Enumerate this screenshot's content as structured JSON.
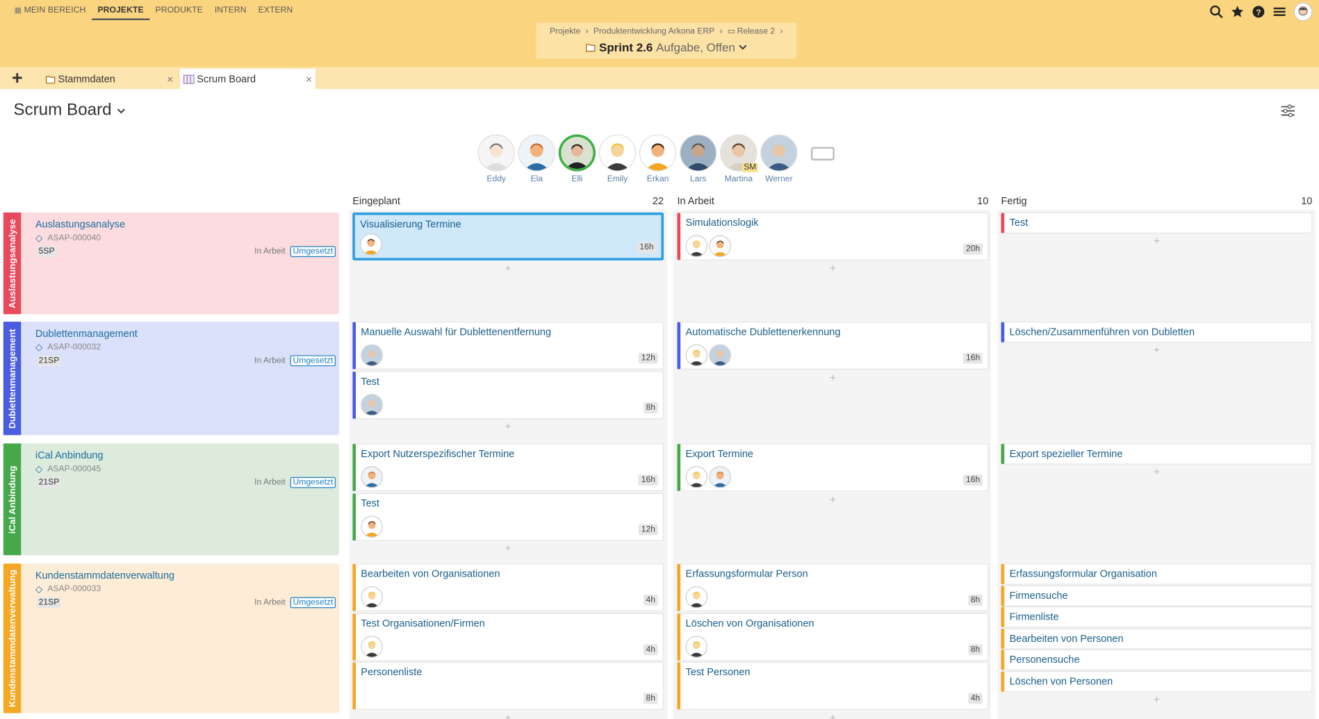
{
  "topnav": {
    "items": [
      {
        "label": "MEIN BEREICH"
      },
      {
        "label": "PROJEKTE"
      },
      {
        "label": "PRODUKTE"
      },
      {
        "label": "INTERN"
      },
      {
        "label": "EXTERN"
      }
    ]
  },
  "breadcrumb": {
    "items": [
      "Projekte",
      "Produktentwicklung Arkona ERP",
      "Release 2"
    ],
    "sprint_name": "Sprint 2.6",
    "sprint_status": "Aufgabe, Offen"
  },
  "tabs": [
    {
      "label": "Stammdaten"
    },
    {
      "label": "Scrum Board"
    }
  ],
  "page": {
    "title": "Scrum Board"
  },
  "team": {
    "members": [
      "Eddy",
      "Ela",
      "Elli",
      "Emily",
      "Erkan",
      "Lars",
      "Martina",
      "Werner"
    ],
    "sm_badge": "SM"
  },
  "columns": [
    {
      "name": "Eingeplant",
      "count": "22"
    },
    {
      "name": "In Arbeit",
      "count": "10"
    },
    {
      "name": "Fertig",
      "count": "10"
    }
  ],
  "rows": [
    {
      "title": "Auslastungsanalyse",
      "id": "ASAP-000040",
      "sp": "5SP",
      "status": "In Arbeit",
      "badge": "Umgesetzt",
      "color": "#e9495c",
      "bg": "#fddcdf"
    },
    {
      "title": "Dublettenmanagement",
      "id": "ASAP-000032",
      "sp": "21SP",
      "status": "In Arbeit",
      "badge": "Umgesetzt",
      "color": "#4a5ce0",
      "bg": "#dbe0fb"
    },
    {
      "title": "iCal Anbindung",
      "id": "ASAP-000045",
      "sp": "21SP",
      "status": "In Arbeit",
      "badge": "Umgesetzt",
      "color": "#46a84a",
      "bg": "#dcebdc"
    },
    {
      "title": "Kundenstammdatenverwaltung",
      "id": "ASAP-000033",
      "sp": "21SP",
      "status": "In Arbeit",
      "badge": "Umgesetzt",
      "color": "#f5a623",
      "bg": "#fdecd6"
    }
  ],
  "cards": {
    "r0c0": [
      {
        "title": "Visualisierung Termine",
        "hours": "16h"
      }
    ],
    "r0c1": [
      {
        "title": "Simulationslogik",
        "hours": "20h"
      }
    ],
    "r0c2": [
      {
        "title": "Test"
      }
    ],
    "r1c0": [
      {
        "title": "Manuelle Auswahl für Dublettenentfernung",
        "hours": "12h"
      },
      {
        "title": "Test",
        "hours": "8h"
      }
    ],
    "r1c1": [
      {
        "title": "Automatische Dublettenerkennung",
        "hours": "16h"
      }
    ],
    "r1c2": [
      {
        "title": "Löschen/Zusammenführen von Dubletten"
      }
    ],
    "r2c0": [
      {
        "title": "Export Nutzerspezifischer Termine",
        "hours": "16h"
      },
      {
        "title": "Test",
        "hours": "12h"
      }
    ],
    "r2c1": [
      {
        "title": "Export Termine",
        "hours": "16h"
      }
    ],
    "r2c2": [
      {
        "title": "Export spezieller Termine"
      }
    ],
    "r3c0": [
      {
        "title": "Bearbeiten von Organisationen",
        "hours": "4h"
      },
      {
        "title": "Test Organisationen/Firmen",
        "hours": "4h"
      },
      {
        "title": "Personenliste",
        "hours": "8h"
      }
    ],
    "r3c1": [
      {
        "title": "Erfassungsformular Person",
        "hours": "8h"
      },
      {
        "title": "Löschen von Organisationen",
        "hours": "8h"
      },
      {
        "title": "Test Personen",
        "hours": "4h"
      }
    ],
    "r3c2": [
      {
        "title": "Erfassungsformular Organisation"
      },
      {
        "title": "Firmensuche"
      },
      {
        "title": "Firmenliste"
      },
      {
        "title": "Bearbeiten von Personen"
      },
      {
        "title": "Personensuche"
      },
      {
        "title": "Löschen von Personen"
      }
    ]
  },
  "add_symbol": "+"
}
